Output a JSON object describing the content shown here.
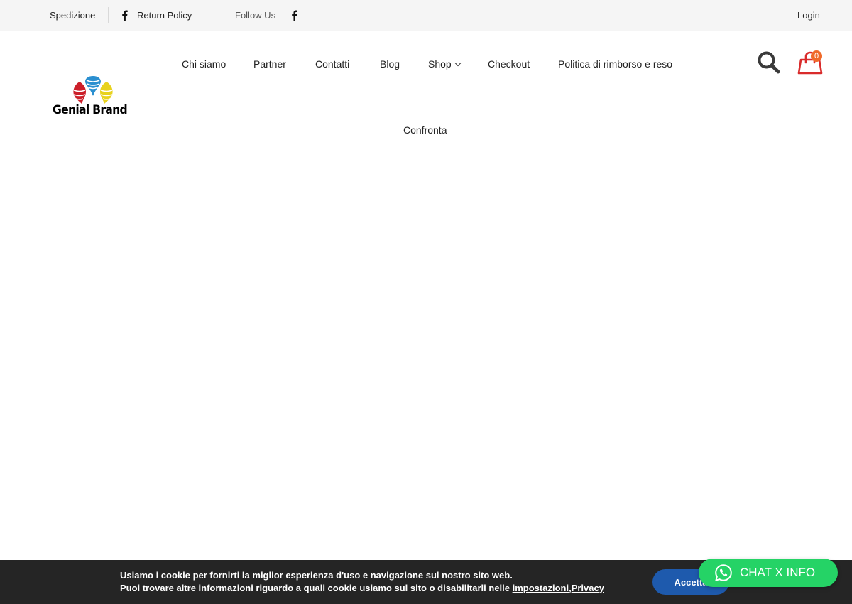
{
  "topbar": {
    "shipping_label": "Spedizione",
    "return_policy_label": "Return Policy",
    "follow_us_label": "Follow Us",
    "login_label": "Login"
  },
  "logo": {
    "text": "Genial Brand"
  },
  "nav": {
    "items": [
      {
        "label": "Chi siamo"
      },
      {
        "label": "Partner"
      },
      {
        "label": "Contatti"
      },
      {
        "label": "Blog"
      },
      {
        "label": "Shop"
      },
      {
        "label": "Checkout"
      },
      {
        "label": "Politica di rimborso e reso"
      },
      {
        "label": "Confronta"
      }
    ]
  },
  "cart": {
    "count": "0"
  },
  "cookie": {
    "line1": "Usiamo i cookie per fornirti la miglior esperienza d'uso e navigazione sul nostro sito web.",
    "line2_prefix": "Puoi trovare altre informazioni riguardo a quali cookie usiamo sul sito o disabilitarli nelle ",
    "settings_link": "impostazioni",
    "privacy_link": "Privacy",
    "accept_label": "Accetta"
  },
  "chat": {
    "label": "CHAT X INFO"
  },
  "colors": {
    "topbar_bg": "#f5f5f5",
    "cart_red": "#d92b2b",
    "badge": "#f06a2a",
    "cookie_bg": "#252525",
    "accept_blue": "#1e5aad",
    "whatsapp_green": "#25d366"
  },
  "icons": [
    "facebook-icon",
    "search-icon",
    "cart-icon",
    "chevron-down-icon",
    "whatsapp-icon"
  ]
}
